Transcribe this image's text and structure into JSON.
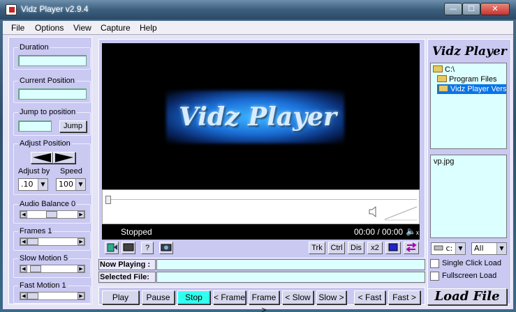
{
  "window": {
    "title": "Vidz Player v2.9.4",
    "min_glyph": "—",
    "max_glyph": "☐",
    "close_glyph": "✕"
  },
  "menu": [
    "File",
    "Options",
    "View",
    "Capture",
    "Help"
  ],
  "left": {
    "duration_label": "Duration",
    "current_position_label": "Current Position",
    "jump_label": "Jump to position",
    "jump_button": "Jump",
    "adjust_position_label": "Adjust Position",
    "adjust_by_label": "Adjust by",
    "speed_label": "Speed",
    "adjust_by_value": ".10",
    "speed_value": "100",
    "audio_balance_label": "Audio Balance 0",
    "frames_label": "Frames 1",
    "slow_motion_label": "Slow Motion 5",
    "fast_motion_label": "Fast Motion 1"
  },
  "video": {
    "logo": "Vidz Player",
    "status": "Stopped",
    "time": "00:00 / 00:00",
    "mute_glyph": "🔈ₓ"
  },
  "toolbar": {
    "help": "?",
    "trk": "Trk",
    "ctrl": "Ctrl",
    "dis": "Dis",
    "x2": "x2"
  },
  "info": {
    "now_playing_label": "Now Playing :",
    "selected_file_label": "Selected File:",
    "now_playing_value": "",
    "selected_file_value": ""
  },
  "playback": [
    "Play",
    "Pause",
    "Stop",
    "< Frame",
    "Frame >",
    "< Slow",
    "Slow >",
    "< Fast",
    "Fast >"
  ],
  "right": {
    "title": "Vidz Player",
    "tree": [
      "C:\\",
      "Program Files",
      "Vidz Player Versio"
    ],
    "files": [
      "vp.jpg"
    ],
    "drive": "c:",
    "filter": "All",
    "single_click_label": "Single Click Load",
    "fullscreen_label": "Fullscreen Load",
    "load_button": "Load File"
  },
  "colors": {
    "stop_active": "#33ffee",
    "field_bg": "#dcffff",
    "panel_bg": "#c9c9f2"
  }
}
